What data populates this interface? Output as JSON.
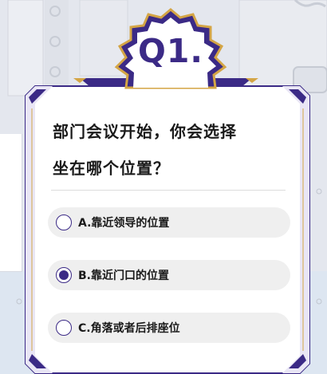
{
  "badge": {
    "text": "Q1."
  },
  "question": {
    "line1": "部门会议开始，你会选择",
    "line2": "坐在哪个位置？"
  },
  "options": [
    {
      "label": "A.靠近领导的位置",
      "selected": false
    },
    {
      "label": "B.靠近门口的位置",
      "selected": true
    },
    {
      "label": "C.角落或者后排座位",
      "selected": false
    }
  ],
  "colors": {
    "accent": "#3b2a86",
    "gold": "#d4a545",
    "background": "#e4e7ee",
    "option_bg": "#efefef"
  }
}
